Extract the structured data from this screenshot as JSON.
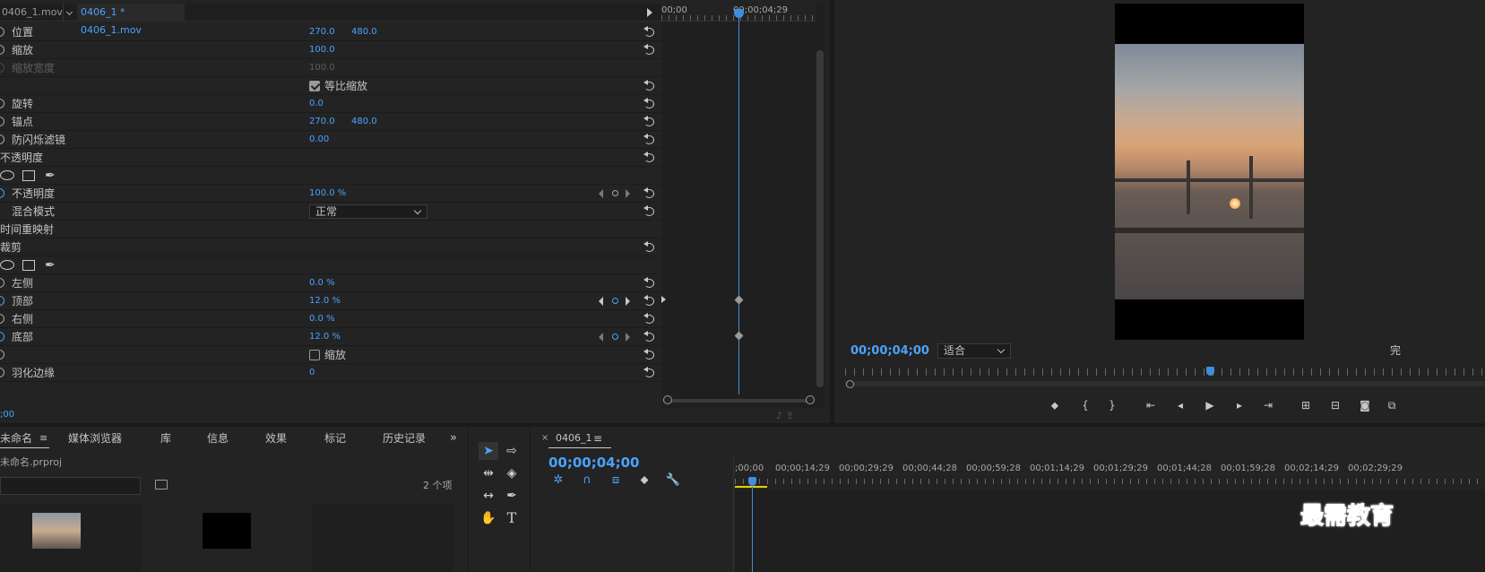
{
  "effect_controls": {
    "source_tab": "0406_1.mov",
    "sequence_tab": "0406_1 * 0406_1.mov",
    "rows": [
      {
        "label": "位置",
        "v1": "270.0",
        "v2": "480.0"
      },
      {
        "label": "缩放",
        "v1": "100.0",
        "v2": ""
      },
      {
        "label": "缩放宽度",
        "v1": "100.0",
        "v2": ""
      },
      {
        "label": "",
        "check_label": "等比缩放"
      },
      {
        "label": "旋转",
        "v1": "0.0",
        "v2": ""
      },
      {
        "label": "锚点",
        "v1": "270.0",
        "v2": "480.0"
      },
      {
        "label": "防闪烁滤镜",
        "v1": "0.00",
        "v2": ""
      },
      {
        "label": "不透明度"
      },
      {
        "label": ""
      },
      {
        "label": "不透明度",
        "v1": "100.0 %"
      },
      {
        "label": "混合模式",
        "select": "正常"
      },
      {
        "label": "时间重映射"
      },
      {
        "label": "裁剪"
      },
      {
        "label": ""
      },
      {
        "label": "左侧",
        "v1": "0.0 %"
      },
      {
        "label": "顶部",
        "v1": "12.0 %"
      },
      {
        "label": "右侧",
        "v1": "0.0 %"
      },
      {
        "label": "底部",
        "v1": "12.0 %"
      },
      {
        "label": "",
        "check_label": "缩放"
      },
      {
        "label": "羽化边缘",
        "v1": "0"
      }
    ],
    "ruler_start": "00;00",
    "ruler_end": "00;00;04;29",
    "status_time": ";00"
  },
  "monitor": {
    "timecode": "00;00;04;00",
    "fit": "适合",
    "quality": "完"
  },
  "project": {
    "tabs": [
      "未命名",
      "媒体浏览器",
      "库",
      "信息",
      "效果",
      "标记",
      "历史记录"
    ],
    "menu_icon": "≡",
    "more": "»",
    "file": "未命名.prproj",
    "count": "2 个项"
  },
  "timeline": {
    "close": "×",
    "sequence": "0406_1",
    "menu": "≡",
    "timecode": "00;00;04;00",
    "ruler": [
      ";00;00",
      "00;00;14;29",
      "00;00;29;29",
      "00;00;44;28",
      "00;00;59;28",
      "00;01;14;29",
      "00;01;29;29",
      "00;01;44;28",
      "00;01;59;28",
      "00;02;14;29",
      "00;02;29;29"
    ]
  },
  "watermark": "最需教育",
  "colors": {
    "accent": "#4aa3ff",
    "background": "#232323",
    "work_area": "#e8d000"
  }
}
